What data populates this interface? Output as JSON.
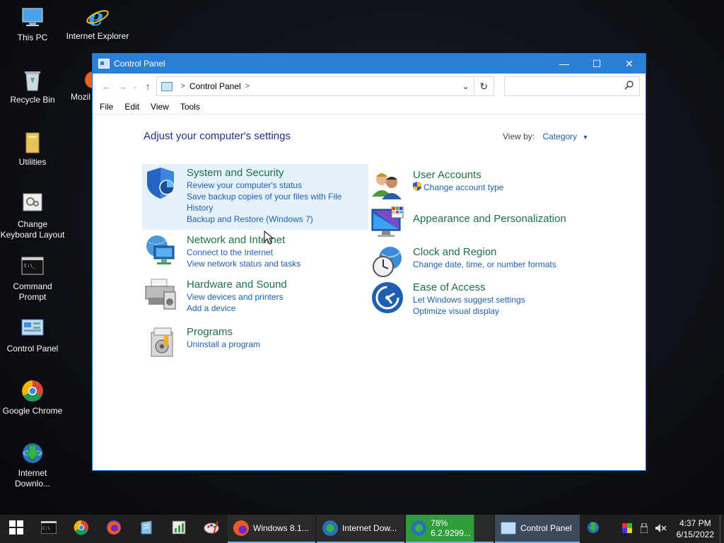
{
  "desktop": {
    "icons": [
      {
        "label": "This PC"
      },
      {
        "label": "Internet Explorer"
      },
      {
        "label": "Recycle Bin"
      },
      {
        "label": "Mozil"
      },
      {
        "label": "Utilities"
      },
      {
        "label": "Change Keyboard Layout"
      },
      {
        "label": "Command Prompt"
      },
      {
        "label": "Control Panel"
      },
      {
        "label": "Google Chrome"
      },
      {
        "label": "Internet Downlo..."
      }
    ]
  },
  "window": {
    "title": "Control Panel",
    "controls": {
      "minimize": "—",
      "maximize": "☐",
      "close": "✕"
    },
    "address": {
      "path": "Control Panel",
      "separator": ">"
    },
    "search": {
      "placeholder": ""
    },
    "menu": [
      "File",
      "Edit",
      "View",
      "Tools"
    ],
    "heading": "Adjust your computer's settings",
    "view_by": {
      "label": "View by:",
      "value": "Category"
    },
    "categories_left": [
      {
        "title": "System and Security",
        "links": [
          "Review your computer's status",
          "Save backup copies of your files with File History",
          "Backup and Restore (Windows 7)"
        ]
      },
      {
        "title": "Network and Internet",
        "links": [
          "Connect to the Internet",
          "View network status and tasks"
        ]
      },
      {
        "title": "Hardware and Sound",
        "links": [
          "View devices and printers",
          "Add a device"
        ]
      },
      {
        "title": "Programs",
        "links": [
          "Uninstall a program"
        ]
      }
    ],
    "categories_right": [
      {
        "title": "User Accounts",
        "links": [
          "Change account type"
        ]
      },
      {
        "title": "Appearance and Personalization",
        "links": []
      },
      {
        "title": "Clock and Region",
        "links": [
          "Change date, time, or number formats"
        ]
      },
      {
        "title": "Ease of Access",
        "links": [
          "Let Windows suggest settings",
          "Optimize visual display"
        ]
      }
    ]
  },
  "taskbar": {
    "tasks": [
      {
        "label": "Windows 8.1..."
      },
      {
        "label": "Internet Dow..."
      },
      {
        "label": "78% 6.2.9299..."
      },
      {
        "label": "Control Panel"
      }
    ],
    "clock": {
      "time": "4:37 PM",
      "date": "6/15/2022"
    },
    "colors": {
      "accent": "#2b7fd4",
      "link": "#1e5fb4",
      "category": "#1e7145"
    }
  }
}
